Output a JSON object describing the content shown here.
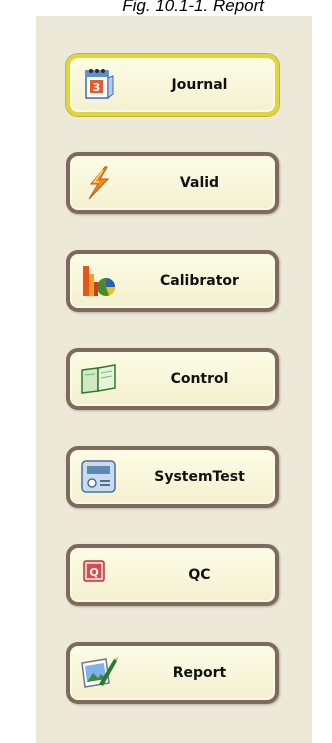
{
  "caption": "Fig. 10.1-1. Report",
  "menu": {
    "items": [
      {
        "label": "Journal",
        "icon": "calendar-icon",
        "active": true
      },
      {
        "label": "Valid",
        "icon": "lightning-icon",
        "active": false
      },
      {
        "label": "Calibrator",
        "icon": "chart-icon",
        "active": false
      },
      {
        "label": "Control",
        "icon": "book-icon",
        "active": false
      },
      {
        "label": "SystemTest",
        "icon": "device-icon",
        "active": false
      },
      {
        "label": "QC",
        "icon": "qc-icon",
        "active": false
      },
      {
        "label": "Report",
        "icon": "picture-icon",
        "active": false
      }
    ]
  },
  "calendar_day": "3",
  "qc_icon_letter": "Q",
  "colors": {
    "panel_bg": "#ece9d8",
    "button_border": "#7d6a5a",
    "active_border": "#e2d53a"
  }
}
